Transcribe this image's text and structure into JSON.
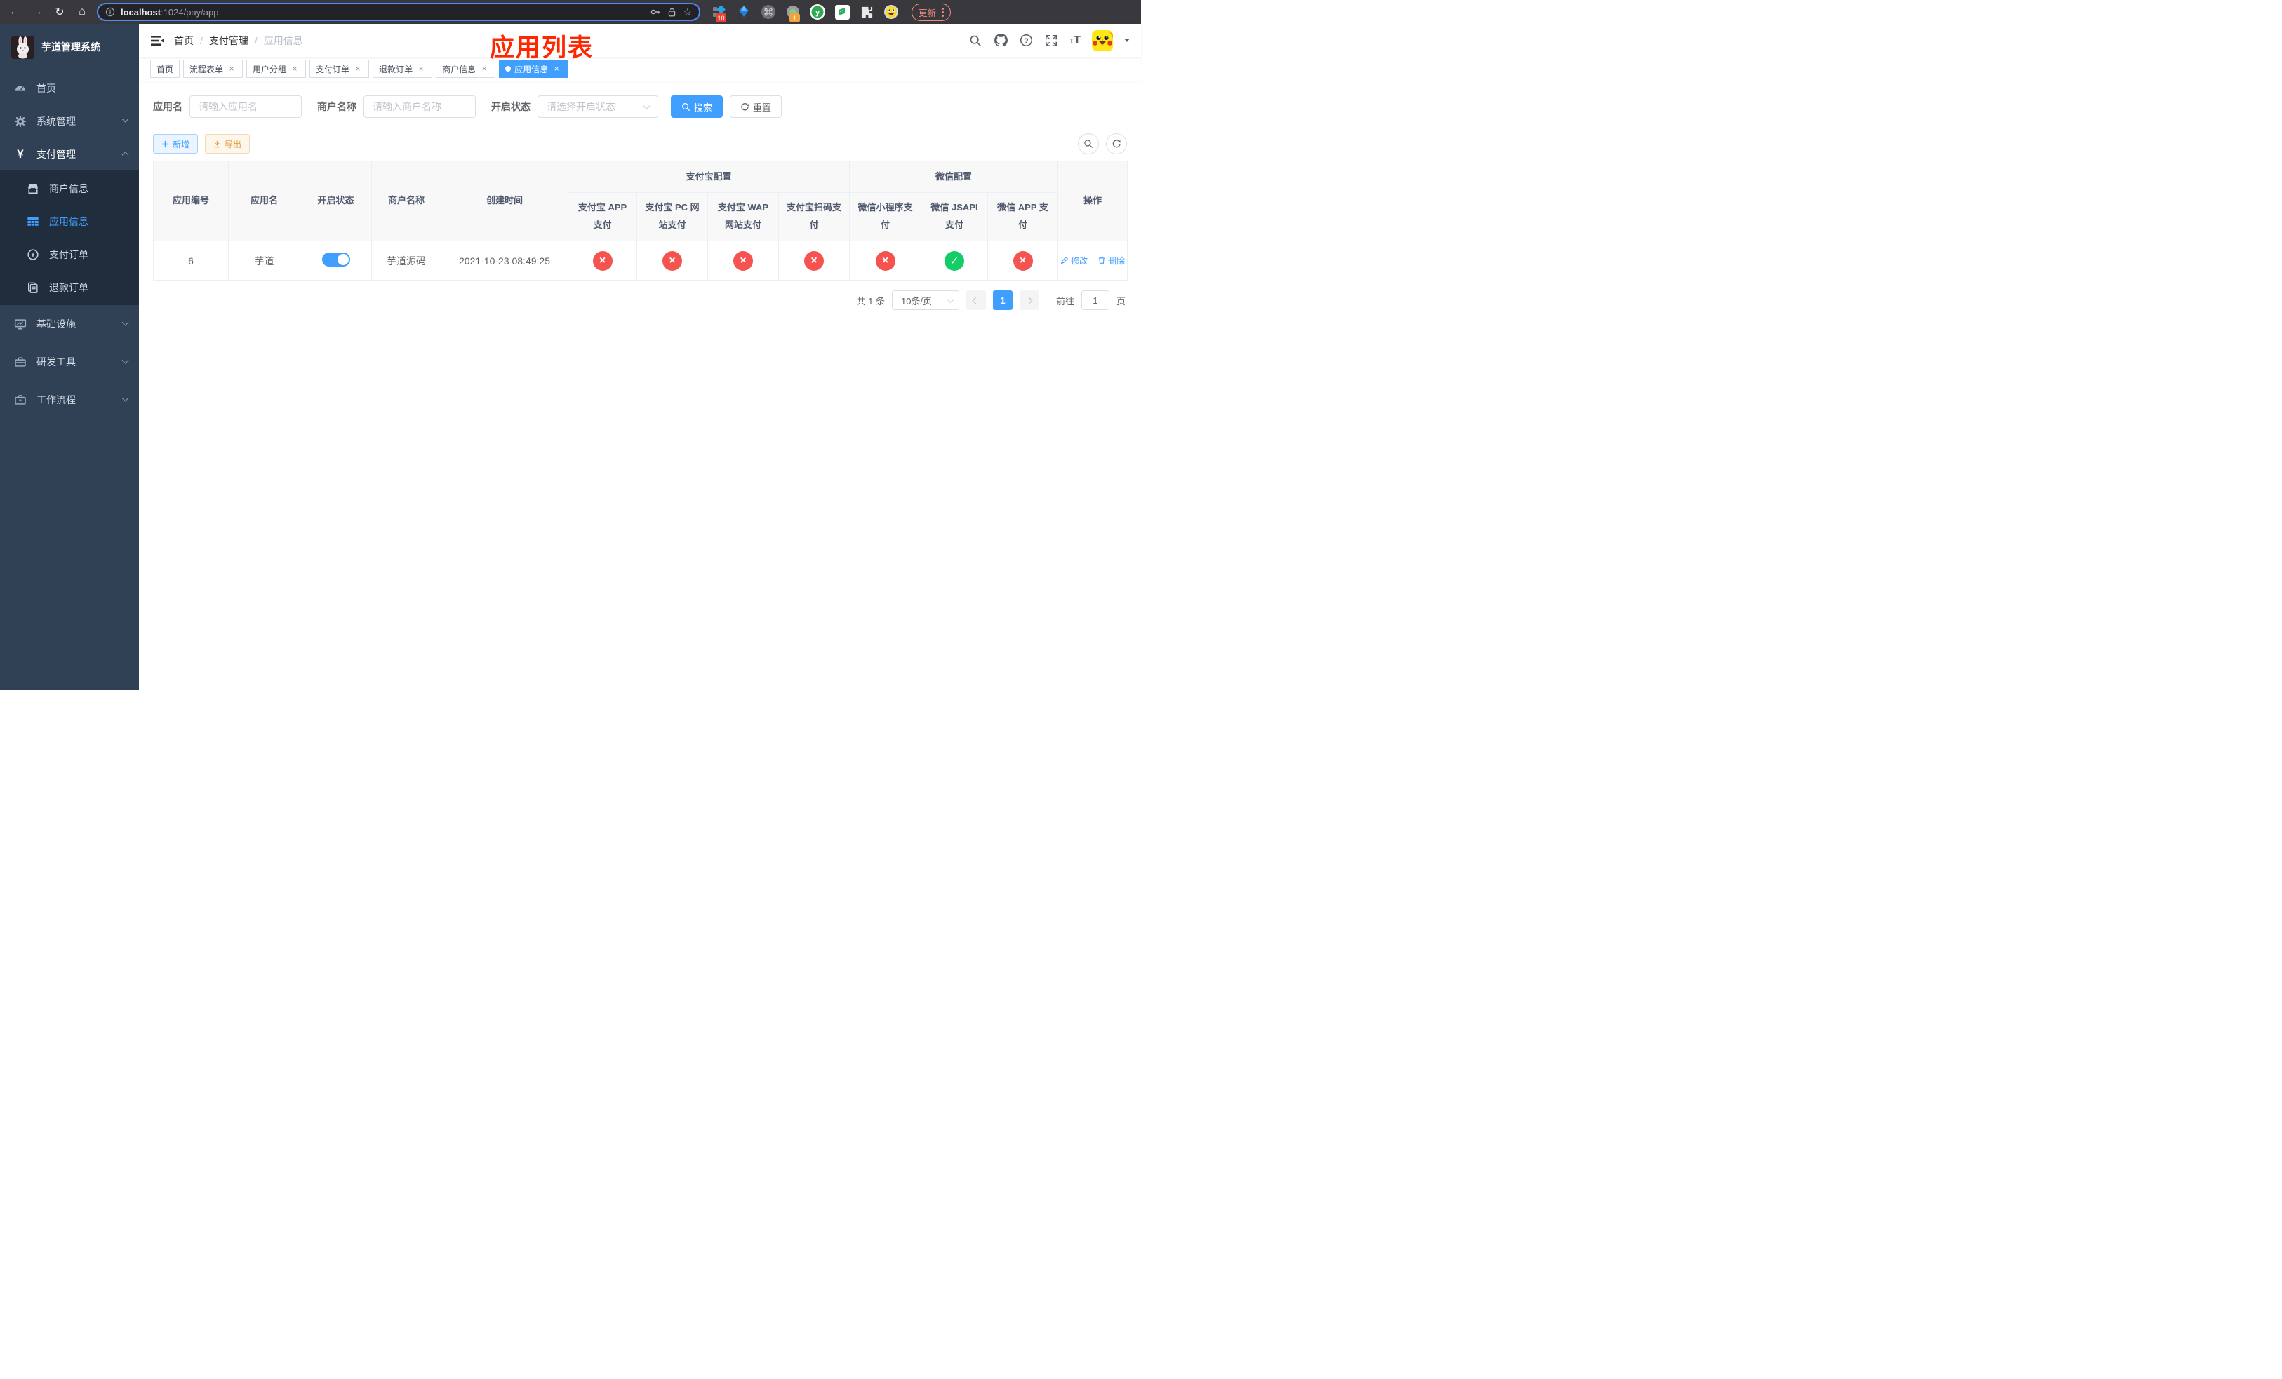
{
  "browser": {
    "url": "localhost:1024/pay/app",
    "url_host": "localhost",
    "url_rest": ":1024/pay/app",
    "update_label": "更新",
    "ext_badge_blue": "10",
    "ext_badge_record": "1"
  },
  "sidebar": {
    "title": "芋道管理系统",
    "items": [
      {
        "label": "首页"
      },
      {
        "label": "系统管理"
      },
      {
        "label": "支付管理"
      },
      {
        "label": "商户信息"
      },
      {
        "label": "应用信息"
      },
      {
        "label": "支付订单"
      },
      {
        "label": "退款订单"
      },
      {
        "label": "基础设施"
      },
      {
        "label": "研发工具"
      },
      {
        "label": "工作流程"
      }
    ]
  },
  "navbar": {
    "breadcrumb": [
      "首页",
      "支付管理",
      "应用信息"
    ],
    "overlay_title": "应用列表"
  },
  "tags": {
    "items": [
      {
        "label": "首页"
      },
      {
        "label": "流程表单"
      },
      {
        "label": "用户分组"
      },
      {
        "label": "支付订单"
      },
      {
        "label": "退款订单"
      },
      {
        "label": "商户信息"
      },
      {
        "label": "应用信息"
      }
    ],
    "close_glyph": "×"
  },
  "filters": {
    "app_name_label": "应用名",
    "app_name_placeholder": "请输入应用名",
    "merchant_label": "商户名称",
    "merchant_placeholder": "请输入商户名称",
    "status_label": "开启状态",
    "status_placeholder": "请选择开启状态",
    "search_label": "搜索",
    "reset_label": "重置"
  },
  "toolbar": {
    "add_label": "新增",
    "export_label": "导出"
  },
  "table": {
    "main_headers": [
      "应用编号",
      "应用名",
      "开启状态",
      "商户名称",
      "创建时间"
    ],
    "group_headers": [
      "支付宝配置",
      "微信配置"
    ],
    "ops_header": "操作",
    "sub_headers": [
      "支付宝 APP 支付",
      "支付宝 PC 网站支付",
      "支付宝 WAP 网站支付",
      "支付宝扫码支付",
      "微信小程序支付",
      "微信 JSAPI 支付",
      "微信 APP 支付"
    ],
    "row": {
      "app_id": "6",
      "app_name": "芋道",
      "enabled": true,
      "merchant_name": "芋道源码",
      "create_time": "2021-10-23 08:49:25",
      "pay_status": [
        "no",
        "no",
        "no",
        "no",
        "no",
        "yes",
        "no"
      ],
      "edit_label": "修改",
      "delete_label": "删除"
    }
  },
  "pagination": {
    "total": "共 1 条",
    "page_size": "10条/页",
    "page": "1",
    "goto_label": "前往",
    "goto_value": "1",
    "page_unit": "页"
  },
  "colors": {
    "accent": "#409eff",
    "danger": "#f5534f",
    "success": "#13ce66",
    "warning": "#e6a23c",
    "annotation_red": "#ff2600"
  }
}
